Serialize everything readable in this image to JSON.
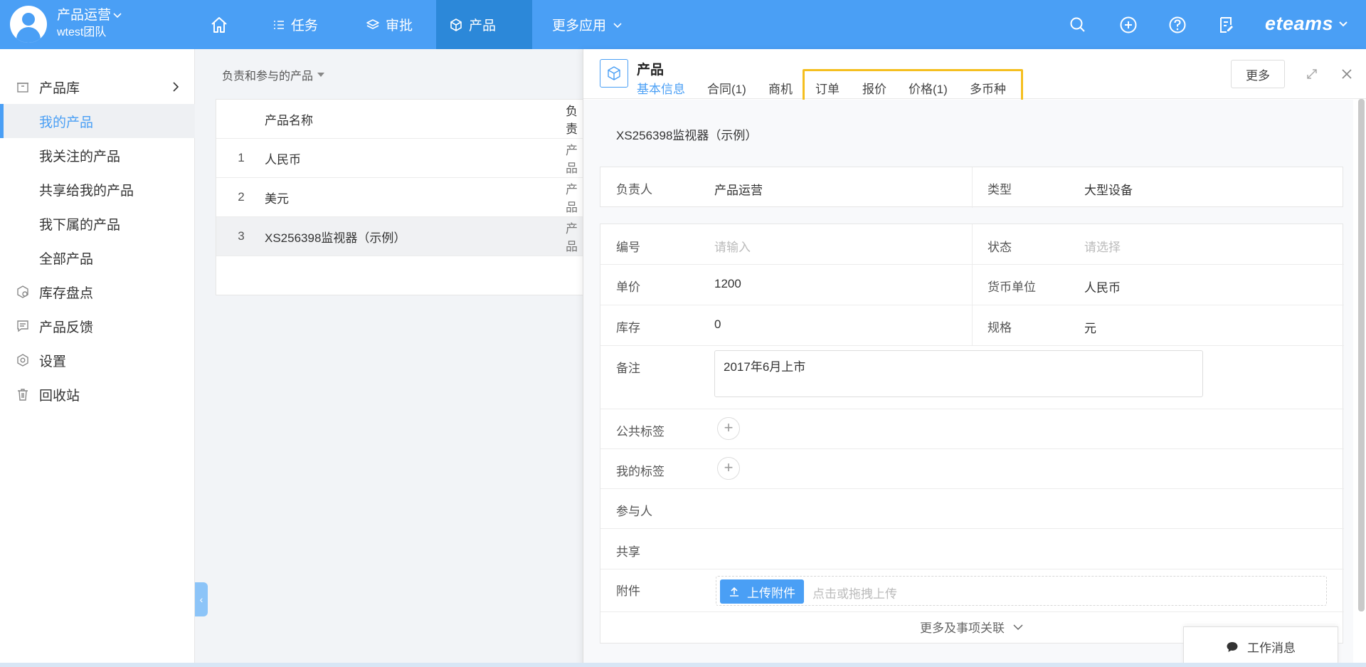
{
  "topbar": {
    "user_name": "产品运营",
    "team_name": "wtest团队",
    "nav": [
      {
        "label": "任务"
      },
      {
        "label": "审批"
      },
      {
        "label": "产品"
      },
      {
        "label": "更多应用"
      }
    ],
    "brand": "eteams",
    "icons": [
      "home-icon",
      "search-icon",
      "add-circle-icon",
      "help-icon",
      "notes-icon"
    ],
    "accent_color": "#4a9ff5"
  },
  "sidebar": {
    "items": [
      {
        "label": "产品库",
        "icon": "box-icon"
      },
      {
        "label": "我的产品"
      },
      {
        "label": "我关注的产品"
      },
      {
        "label": "共享给我的产品"
      },
      {
        "label": "我下属的产品"
      },
      {
        "label": "全部产品"
      },
      {
        "label": "库存盘点",
        "icon": "inventory-icon"
      },
      {
        "label": "产品反馈",
        "icon": "feedback-icon"
      },
      {
        "label": "设置",
        "icon": "settings-icon"
      },
      {
        "label": "回收站",
        "icon": "trash-icon"
      }
    ]
  },
  "list": {
    "filter_label": "负责和参与的产品",
    "columns": {
      "name": "产品名称",
      "owner": "负责"
    },
    "rows": [
      {
        "num": "1",
        "name": "人民币",
        "owner": "产品"
      },
      {
        "num": "2",
        "name": "美元",
        "owner": "产品"
      },
      {
        "num": "3",
        "name": "XS256398监视器（示例）",
        "owner": "产品"
      }
    ]
  },
  "panel": {
    "title": "产品",
    "tabs": [
      {
        "label": "基本信息"
      },
      {
        "label": "合同(1)"
      },
      {
        "label": "商机"
      },
      {
        "label": "订单"
      },
      {
        "label": "报价"
      },
      {
        "label": "价格(1)"
      },
      {
        "label": "多币种"
      }
    ],
    "more_label": "更多",
    "product_name": "XS256398监视器（示例）",
    "fields": {
      "owner_label": "负责人",
      "owner_value": "产品运营",
      "type_label": "类型",
      "type_value": "大型设备",
      "code_label": "编号",
      "code_placeholder": "请输入",
      "status_label": "状态",
      "status_placeholder": "请选择",
      "price_label": "单价",
      "price_value": "1200",
      "currency_label": "货币单位",
      "currency_value": "人民币",
      "stock_label": "库存",
      "stock_value": "0",
      "spec_label": "规格",
      "spec_value": "元",
      "remark_label": "备注",
      "remark_value": "2017年6月上市",
      "public_tags_label": "公共标签",
      "my_tags_label": "我的标签",
      "participants_label": "参与人",
      "share_label": "共享",
      "attachment_label": "附件",
      "upload_label": "上传附件",
      "upload_hint": "点击或拖拽上传"
    },
    "more_links_label": "更多及事项关联",
    "highlight_color": "#f5bf1f"
  },
  "work_message": {
    "label": "工作消息"
  }
}
